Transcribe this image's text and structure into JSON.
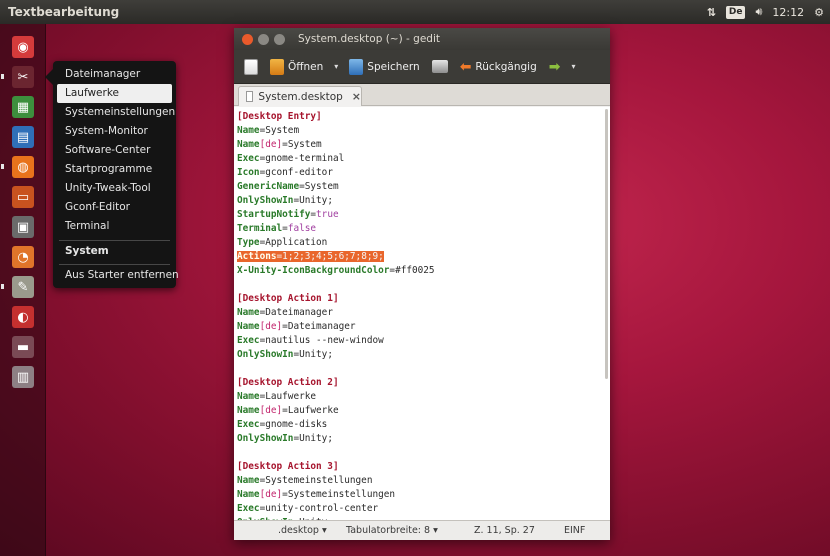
{
  "top_panel": {
    "app_title": "Textbearbeitung",
    "keyboard_layout": "De",
    "clock": "12:12"
  },
  "quicklist": {
    "items": [
      {
        "label": "Dateimanager"
      },
      {
        "label": "Laufwerke"
      },
      {
        "label": "Systemeinstellungen"
      },
      {
        "label": "System-Monitor"
      },
      {
        "label": "Software-Center"
      },
      {
        "label": "Startprogramme"
      },
      {
        "label": "Unity-Tweak-Tool"
      },
      {
        "label": "Gconf-Editor"
      },
      {
        "label": "Terminal"
      }
    ],
    "app_name": "System",
    "remove_label": "Aus Starter entfernen"
  },
  "gedit": {
    "title": "System.desktop (~) - gedit",
    "toolbar": {
      "open_label": "Öffnen",
      "save_label": "Speichern",
      "undo_label": "Rückgängig"
    },
    "tab_label": "System.desktop",
    "tab_close": "×",
    "statusbar": {
      "language": ".desktop",
      "tab_width": "Tabulatorbreite: 8",
      "cursor": "Z. 11, Sp. 27",
      "mode": "EINF"
    },
    "lines": [
      {
        "section": "[Desktop Entry]"
      },
      {
        "key": "Name",
        "value": "System"
      },
      {
        "key": "Name",
        "locale": "[de]",
        "value": "System"
      },
      {
        "key": "Exec",
        "value": "gnome-terminal"
      },
      {
        "key": "Icon",
        "value": "gconf-editor"
      },
      {
        "key": "GenericName",
        "value": "System"
      },
      {
        "key": "OnlyShowIn",
        "value": "Unity;"
      },
      {
        "key": "StartupNotify",
        "value": "true",
        "value_kind": "keyword"
      },
      {
        "key": "Terminal",
        "value": "false",
        "value_kind": "keyword"
      },
      {
        "key": "Type",
        "value": "Application"
      },
      {
        "key": "Actions",
        "value": "1;2;3;4;5;6;7;8;9;",
        "highlight": true
      },
      {
        "key": "X-Unity-IconBackgroundColor",
        "value": "#ff0025"
      },
      {
        "blank": true
      },
      {
        "section": "[Desktop Action 1]"
      },
      {
        "key": "Name",
        "value": "Dateimanager"
      },
      {
        "key": "Name",
        "locale": "[de]",
        "value": "Dateimanager"
      },
      {
        "key": "Exec",
        "value": "nautilus --new-window"
      },
      {
        "key": "OnlyShowIn",
        "value": "Unity;"
      },
      {
        "blank": true
      },
      {
        "section": "[Desktop Action 2]"
      },
      {
        "key": "Name",
        "value": "Laufwerke"
      },
      {
        "key": "Name",
        "locale": "[de]",
        "value": "Laufwerke"
      },
      {
        "key": "Exec",
        "value": "gnome-disks"
      },
      {
        "key": "OnlyShowIn",
        "value": "Unity;"
      },
      {
        "blank": true
      },
      {
        "section": "[Desktop Action 3]"
      },
      {
        "key": "Name",
        "value": "Systemeinstellungen"
      },
      {
        "key": "Name",
        "locale": "[de]",
        "value": "Systemeinstellungen"
      },
      {
        "key": "Exec",
        "value": "unity-control-center"
      },
      {
        "key": "OnlyShowIn",
        "value": "Unity;"
      }
    ]
  },
  "launcher": {
    "icons": [
      {
        "name": "dash-home-icon",
        "color": "#d43b3b"
      },
      {
        "name": "system-tools-icon",
        "color": "#6b2530"
      },
      {
        "name": "libreoffice-calc-icon",
        "color": "#3d8f3d"
      },
      {
        "name": "libreoffice-writer-icon",
        "color": "#2f6fb8"
      },
      {
        "name": "firefox-icon",
        "color": "#e8731c"
      },
      {
        "name": "libreoffice-impress-icon",
        "color": "#c8521f"
      },
      {
        "name": "screenshot-icon",
        "color": "#6a6a6a"
      },
      {
        "name": "software-updater-icon",
        "color": "#e0742a"
      },
      {
        "name": "text-editor-icon",
        "color": "#9a9a8c"
      },
      {
        "name": "software-center-icon",
        "color": "#c4302f"
      },
      {
        "name": "removable-drive-icon",
        "color": "#7a4a55"
      },
      {
        "name": "trash-icon",
        "color": "#8d7f84"
      }
    ]
  },
  "colors": {
    "accent_selection": "#e9662c",
    "section_red": "#a6142d",
    "key_green": "#2a7a2a",
    "keyword_purple": "#a13fa0"
  }
}
